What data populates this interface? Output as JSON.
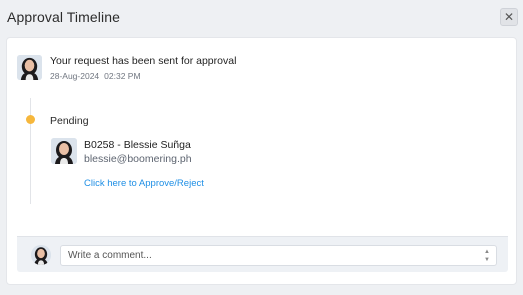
{
  "dialog": {
    "title": "Approval Timeline",
    "close_icon": "close-icon"
  },
  "request": {
    "message": "Your request has been sent for approval",
    "date": "28-Aug-2024",
    "time": "02:32 PM"
  },
  "timeline": {
    "status": "Pending",
    "status_color": "#f6b73c",
    "approver": {
      "name": "B0258 - Blessie Suñga",
      "email": "blessie@boomering.ph"
    },
    "action_link": "Click here to Approve/Reject",
    "link_color": "#1f8fe5"
  },
  "comment": {
    "placeholder": "Write a comment..."
  }
}
